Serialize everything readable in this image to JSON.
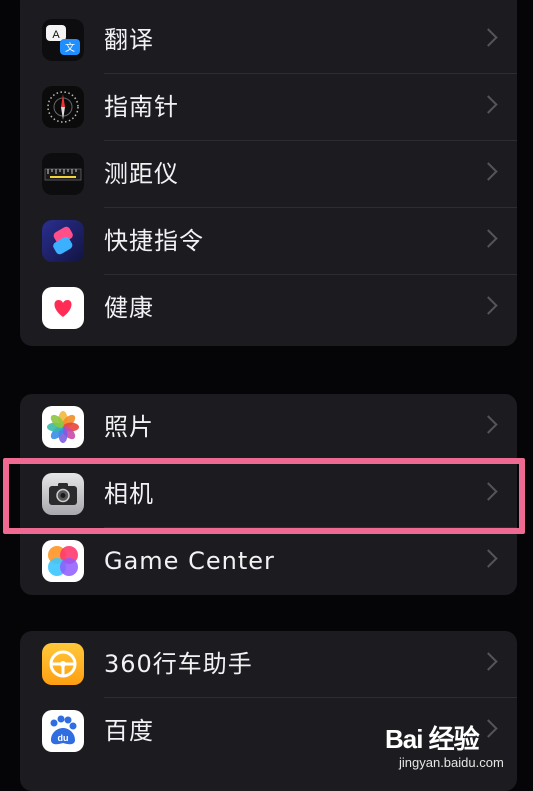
{
  "groups": [
    {
      "items": [
        {
          "label": "翻译",
          "icon": "translate-icon"
        },
        {
          "label": "指南针",
          "icon": "compass-icon"
        },
        {
          "label": "测距仪",
          "icon": "measure-icon"
        },
        {
          "label": "快捷指令",
          "icon": "shortcuts-icon"
        },
        {
          "label": "健康",
          "icon": "health-icon"
        }
      ]
    },
    {
      "items": [
        {
          "label": "照片",
          "icon": "photos-icon"
        },
        {
          "label": "相机",
          "icon": "camera-icon",
          "highlighted": true
        },
        {
          "label": "Game Center",
          "icon": "game-center-icon"
        }
      ]
    },
    {
      "items": [
        {
          "label": "360行车助手",
          "icon": "360-drive-assistant-icon"
        },
        {
          "label": "百度",
          "icon": "baidu-icon"
        }
      ]
    }
  ],
  "translate_icon_glyphs": {
    "a": "A",
    "b": "文"
  },
  "baidu_icon_text": "du",
  "watermark": {
    "brand": "Bai 经验",
    "site": "jingyan.baidu.com"
  },
  "colors": {
    "background": "#050406",
    "group_bg": "#1c1b1f",
    "highlight": "#ee6a93"
  }
}
